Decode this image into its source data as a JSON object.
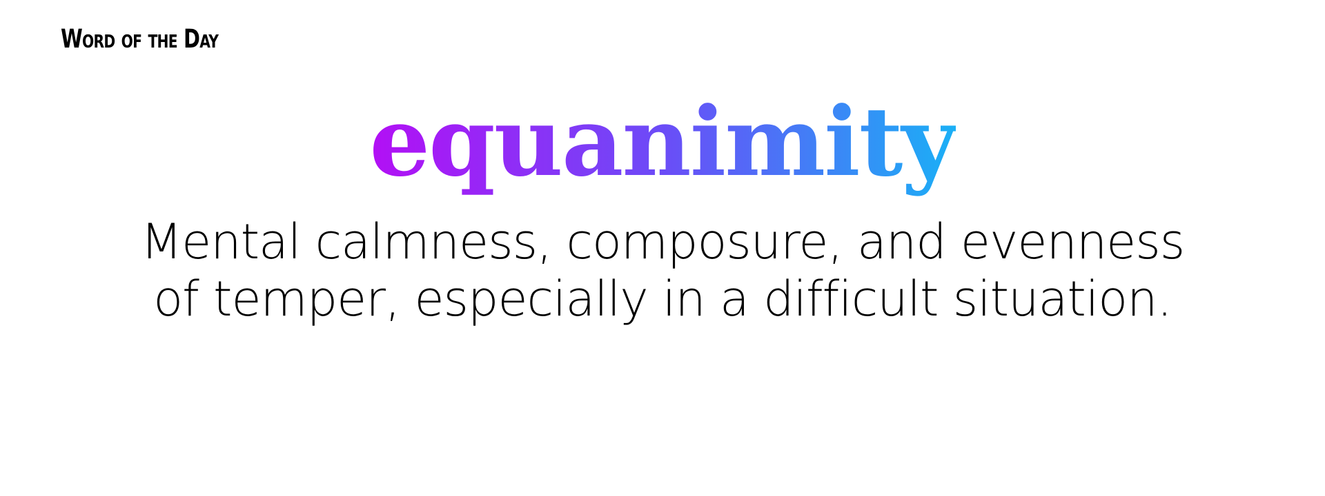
{
  "header": {
    "label": "Word of the Day"
  },
  "word": {
    "text": "equanimity",
    "gradient_colors": [
      "#b30ff5",
      "#6b4cf7",
      "#1ab0f6"
    ]
  },
  "definition": {
    "text": "Mental calmness, composure, and evenness of temper, especially in a difficult situation."
  }
}
